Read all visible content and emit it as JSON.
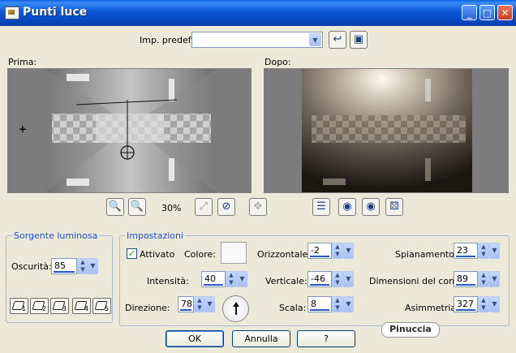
{
  "window": {
    "title": "Punti luce",
    "controls": [
      "minimize-icon",
      "maximize-icon",
      "close-icon"
    ]
  },
  "preset": {
    "label": "Imp. predef.:",
    "value": ""
  },
  "previews": {
    "before_label": "Prima:",
    "after_label": "Dopo:"
  },
  "zoom": {
    "value": "30%"
  },
  "light_source": {
    "group_label": "Sorgente luminosa",
    "darkness_label": "Oscurità:",
    "darkness_value": "85",
    "presets": [
      "1",
      "2",
      "3",
      "4",
      "5"
    ]
  },
  "settings": {
    "group_label": "Impostazioni",
    "enabled_label": "Attivato",
    "enabled": true,
    "color_label": "Colore:",
    "color_value": "#f8f8f8",
    "intensity_label": "Intensità:",
    "intensity_value": "40",
    "direction_label": "Direzione:",
    "direction_value": "78",
    "horizontal_label": "Orizzontale:",
    "horizontal_value": "-2",
    "vertical_label": "Verticale:",
    "vertical_value": "-46",
    "scale_label": "Scala:",
    "scale_value": "8",
    "flatten_label": "Spianamento:",
    "flatten_value": "23",
    "cone_label": "Dimensioni del cono:",
    "cone_value": "89",
    "asymmetry_label": "Asimmetria:",
    "asymmetry_value": "327"
  },
  "buttons": {
    "ok": "OK",
    "cancel": "Annulla",
    "help": "?"
  },
  "watermark": "Pinuccia"
}
